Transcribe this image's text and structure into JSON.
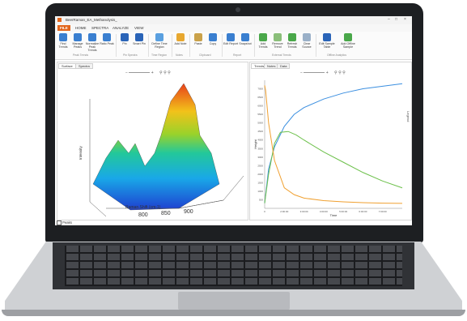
{
  "window": {
    "title": "BeerRaman_EA_Methanolysis_"
  },
  "menu_tabs": [
    "FILE",
    "HOME",
    "SPECTRA",
    "ANALYZE",
    "VIEW"
  ],
  "ribbon": {
    "buttons": [
      {
        "label": "Find Trends",
        "color": "#3a7fd0"
      },
      {
        "label": "Manage Peaks",
        "color": "#3a7fd0"
      },
      {
        "label": "Normalize Peak Trends",
        "color": "#3a7fd0"
      },
      {
        "label": "Ratio Peak",
        "color": "#3a7fd0"
      },
      {
        "label": "Pin",
        "color": "#2a64b8"
      },
      {
        "label": "Smart Pin",
        "color": "#2a64b8"
      },
      {
        "label": "Define Time Region",
        "color": "#5aa0e0"
      },
      {
        "label": "Add Note",
        "color": "#e8a830"
      },
      {
        "label": "Paste",
        "color": "#caa24a"
      },
      {
        "label": "Copy",
        "color": "#3a7fd0"
      },
      {
        "label": "Edit Report",
        "color": "#3a7fd0"
      },
      {
        "label": "Snapshot",
        "color": "#3a7fd0"
      },
      {
        "label": "Add Trends",
        "color": "#4aa84a"
      },
      {
        "label": "Remove Trend",
        "color": "#8bbf7a"
      },
      {
        "label": "Refresh Trends",
        "color": "#4aa84a"
      },
      {
        "label": "Clear Source",
        "color": "#9ab0c8"
      },
      {
        "label": "Edit Sample Table",
        "color": "#2a64b8"
      },
      {
        "label": "Add Offline Sample",
        "color": "#4aa84a"
      }
    ],
    "groups": [
      "Peak Trends",
      "Pin Spectra",
      "Time Region",
      "Notes",
      "Clipboard",
      "Report",
      "External Trends",
      "Offline Analytics"
    ]
  },
  "left_panel": {
    "tabs": [
      "Surface",
      "Spectra"
    ],
    "x_axis_label": "Raman Shift (cm-1)",
    "x_ticks": [
      "800",
      "850",
      "900"
    ],
    "z_axis_label": "Intensity",
    "status_label": "Peaks"
  },
  "right_panel": {
    "tabs": [
      "Trends",
      "Notes",
      "Data"
    ],
    "legend_label": "Legend",
    "chart_data": {
      "type": "line",
      "ylabel": "Height",
      "xlabel": "Time",
      "y_ticks": [
        500,
        1000,
        1500,
        2000,
        2500,
        3000,
        3500,
        4000,
        4500,
        5000,
        5500,
        6000,
        6500,
        7000
      ],
      "x_ticks": [
        "0",
        "2:00:00",
        "3:00:00",
        "4:00:00",
        "5:00:00",
        "6:00:00",
        "7:00:00"
      ],
      "ylim": [
        0,
        7500
      ],
      "xlim": [
        0,
        7
      ],
      "series": [
        {
          "color": "#3b8fe0",
          "x": [
            0,
            0.2,
            0.5,
            1,
            1.5,
            2,
            3,
            4,
            5,
            6,
            7
          ],
          "y": [
            300,
            2300,
            3600,
            4800,
            5500,
            5900,
            6400,
            6750,
            7000,
            7150,
            7300
          ]
        },
        {
          "color": "#6cc04a",
          "x": [
            0,
            0.2,
            0.5,
            0.8,
            1.2,
            1.6,
            2,
            3,
            4,
            5,
            6,
            7
          ],
          "y": [
            300,
            2000,
            3800,
            4450,
            4500,
            4300,
            4000,
            3300,
            2700,
            2100,
            1600,
            1200
          ]
        },
        {
          "color": "#f0a030",
          "x": [
            0,
            0.05,
            0.2,
            0.5,
            1,
            1.5,
            2,
            3,
            4,
            5,
            6,
            7
          ],
          "y": [
            7200,
            6900,
            5000,
            2800,
            1200,
            800,
            600,
            450,
            380,
            330,
            300,
            290
          ]
        }
      ]
    }
  }
}
